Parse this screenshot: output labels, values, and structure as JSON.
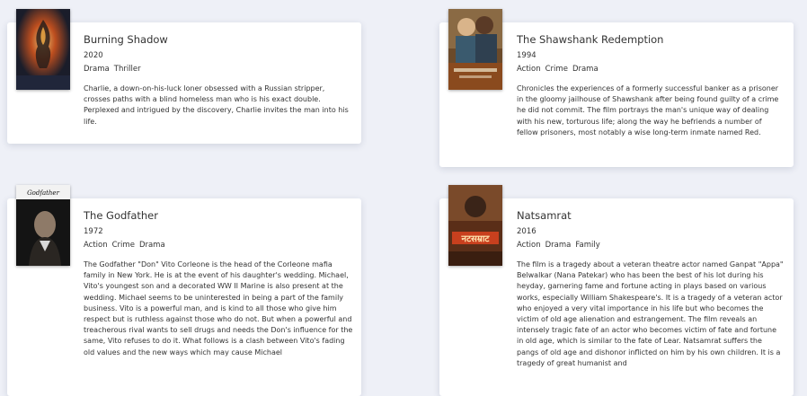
{
  "movies": [
    {
      "title": "Burning Shadow",
      "year": "2020",
      "genres": [
        "Drama",
        "Thriller"
      ],
      "plot": "Charlie, a down-on-his-luck loner obsessed with a Russian stripper, crosses paths with a blind homeless man who is his exact double. Perplexed and intrigued by the discovery, Charlie invites the man into his life.",
      "poster_icon": "burning-figure-poster"
    },
    {
      "title": "The Shawshank Redemption",
      "year": "1994",
      "genres": [
        "Action",
        "Crime",
        "Drama"
      ],
      "plot": "Chronicles the experiences of a formerly successful banker as a prisoner in the gloomy jailhouse of Shawshank after being found guilty of a crime he did not commit. The film portrays the man's unique way of dealing with his new, torturous life; along the way he befriends a number of fellow prisoners, most notably a wise long-term inmate named Red.",
      "poster_icon": "two-men-poster"
    },
    {
      "title": "The Godfather",
      "year": "1972",
      "genres": [
        "Action",
        "Crime",
        "Drama"
      ],
      "plot": "The Godfather \"Don\" Vito Corleone is the head of the Corleone mafia family in New York. He is at the event of his daughter's wedding. Michael, Vito's youngest son and a decorated WW II Marine is also present at the wedding. Michael seems to be uninterested in being a part of the family business. Vito is a powerful man, and is kind to all those who give him respect but is ruthless against those who do not. But when a powerful and treacherous rival wants to sell drugs and needs the Don's influence for the same, Vito refuses to do it. What follows is a clash between Vito's fading old values and the new ways which may cause Michael",
      "poster_icon": "godfather-poster"
    },
    {
      "title": "Natsamrat",
      "year": "2016",
      "genres": [
        "Action",
        "Drama",
        "Family"
      ],
      "plot": "The film is a tragedy about a veteran theatre actor named Ganpat \"Appa\" Belwalkar (Nana Patekar) who has been the best of his lot during his heyday, garnering fame and fortune acting in plays based on various works, especially William Shakespeare's. It is a tragedy of a veteran actor who enjoyed a very vital importance in his life but who becomes the victim of old age alienation and estrangement. The film reveals an intensely tragic fate of an actor who becomes victim of fate and fortune in old age, which is similar to the fate of Lear. Natsamrat suffers the pangs of old age and dishonor inflicted on him by his own children. It is a tragedy of great humanist and",
      "poster_icon": "natsamrat-poster"
    }
  ]
}
